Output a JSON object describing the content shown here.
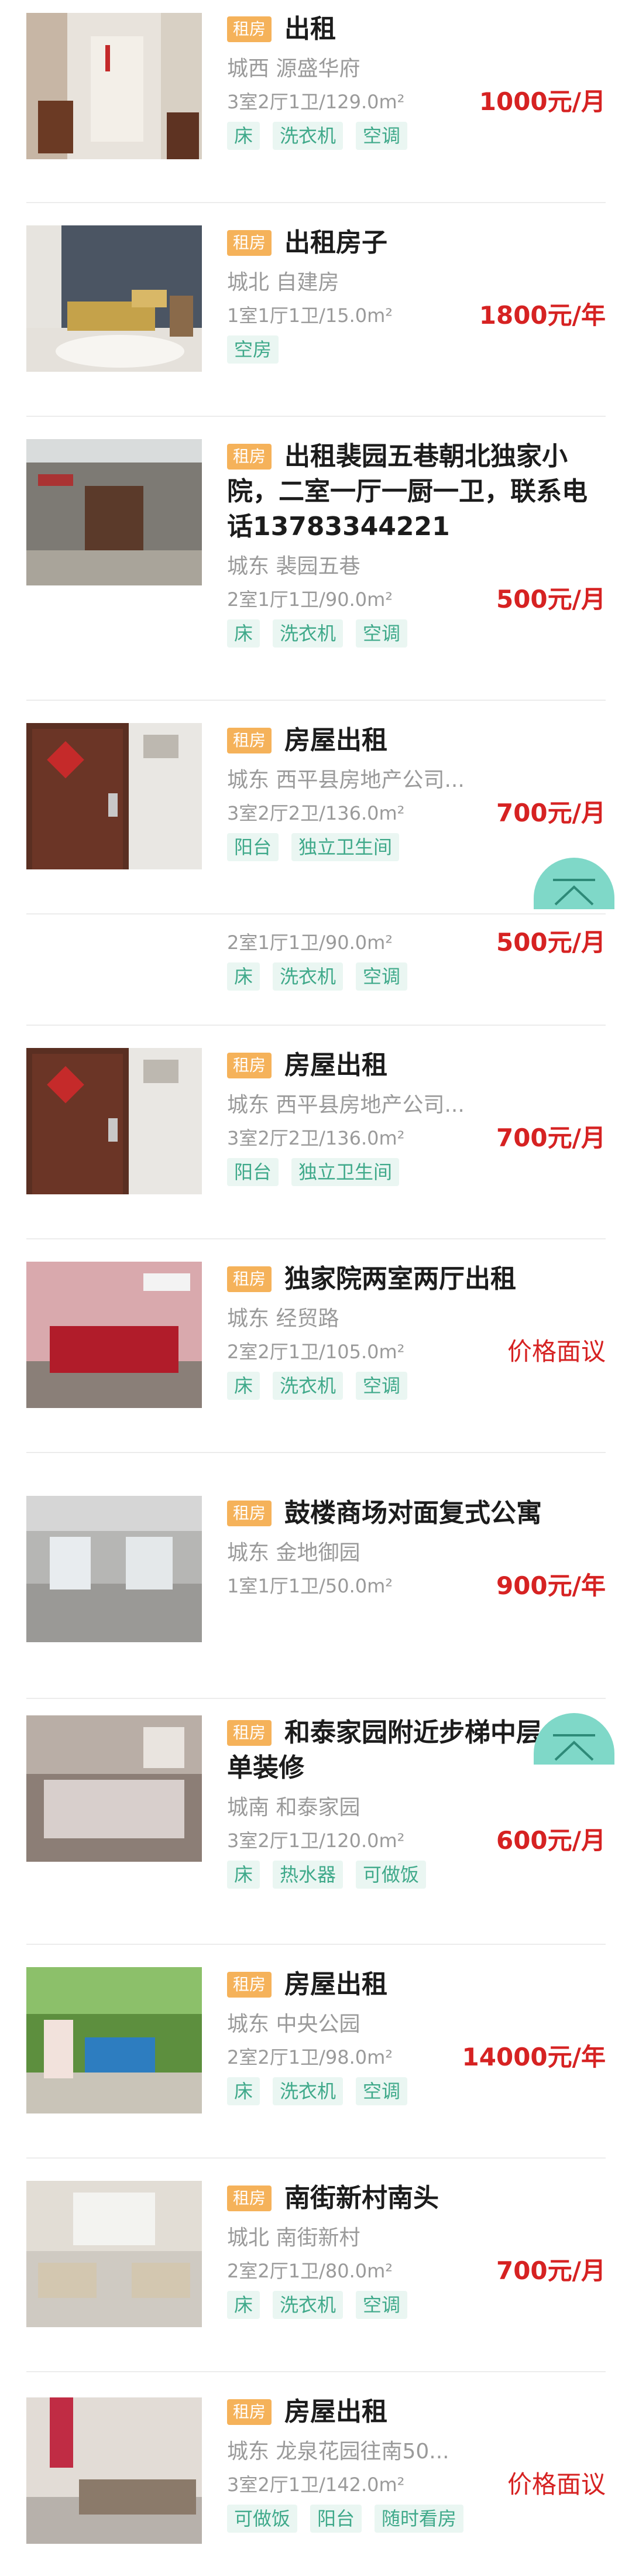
{
  "listings": [
    {
      "tag": "租房",
      "title": "出租",
      "location": "城西 源盛华府",
      "specs": "3室2厅1卫/129.0m²",
      "price": "1000元/月",
      "chips": [
        "床",
        "洗衣机",
        "空调"
      ],
      "photo": "hallway-room-photo"
    },
    {
      "tag": "租房",
      "title": "出租房子",
      "location": "城北 自建房",
      "specs": "1室1厅1卫/15.0m²",
      "price": "1800元/年",
      "chips": [
        "空房"
      ],
      "photo": "bedroom-photo"
    },
    {
      "tag": "租房",
      "title": "出租裴园五巷朝北独家小院，二室一厅一厨一卫，联系电话13783344221",
      "location": "城东 裴园五巷",
      "specs": "2室1厅1卫/90.0m²",
      "price": "500元/月",
      "chips": [
        "床",
        "洗衣机",
        "空调"
      ],
      "photo": "courtyard-photo"
    },
    {
      "tag": "租房",
      "title": "房屋出租",
      "location": "城东 西平县房地产公司...",
      "specs": "3室2厅2卫/136.0m²",
      "price": "700元/月",
      "chips": [
        "阳台",
        "独立卫生间"
      ],
      "photo": "door-photo"
    },
    {
      "tag": "",
      "title": "",
      "location": "",
      "specs": "2室1厅1卫/90.0m²",
      "price": "500元/月",
      "chips": [
        "床",
        "洗衣机",
        "空调"
      ],
      "photo": ""
    },
    {
      "tag": "租房",
      "title": "房屋出租",
      "location": "城东 西平县房地产公司...",
      "specs": "3室2厅2卫/136.0m²",
      "price": "700元/月",
      "chips": [
        "阳台",
        "独立卫生间"
      ],
      "photo": "door-photo"
    },
    {
      "tag": "租房",
      "title": "独家院两室两厅出租",
      "location": "城东 经贸路",
      "specs": "2室2厅1卫/105.0m²",
      "price": "价格面议",
      "chips": [
        "床",
        "洗衣机",
        "空调"
      ],
      "photo": "red-bed-photo"
    },
    {
      "tag": "租房",
      "title": "鼓楼商场对面复式公寓",
      "location": "城东 金地御园",
      "specs": "1室1厅1卫/50.0m²",
      "price": "900元/年",
      "chips": [],
      "photo": "apartment-photo"
    },
    {
      "tag": "租房",
      "title": "和泰家园附近步梯中层，简单装修",
      "location": "城南 和泰家园",
      "specs": "3室2厅1卫/120.0m²",
      "price": "600元/月",
      "chips": [
        "床",
        "热水器",
        "可做饭"
      ],
      "photo": "bed-room-photo"
    },
    {
      "tag": "租房",
      "title": "房屋出租",
      "location": "城东 中央公园",
      "specs": "2室2厅1卫/98.0m²",
      "price": "14000元/年",
      "chips": [
        "床",
        "洗衣机",
        "空调"
      ],
      "photo": "garden-photo"
    },
    {
      "tag": "租房",
      "title": "南街新村南头",
      "location": "城北 南街新村",
      "specs": "2室2厅1卫/80.0m²",
      "price": "700元/月",
      "chips": [
        "床",
        "洗衣机",
        "空调"
      ],
      "photo": "living-room-photo"
    },
    {
      "tag": "租房",
      "title": "房屋出租",
      "location": "城东 龙泉花园往南50...",
      "specs": "3室2厅1卫/142.0m²",
      "price": "价格面议",
      "chips": [
        "可做饭",
        "阳台",
        "随时看房"
      ],
      "photo": "bed-frame-photo"
    }
  ],
  "back_to_top": {
    "icon": "arrow-up-to-top-icon"
  },
  "colors": {
    "price": "#d62222",
    "tag": "#f5b25a",
    "chip_text": "#3fa98a",
    "chip_bg": "#eaf6f2",
    "button": "#7fd8c8"
  }
}
